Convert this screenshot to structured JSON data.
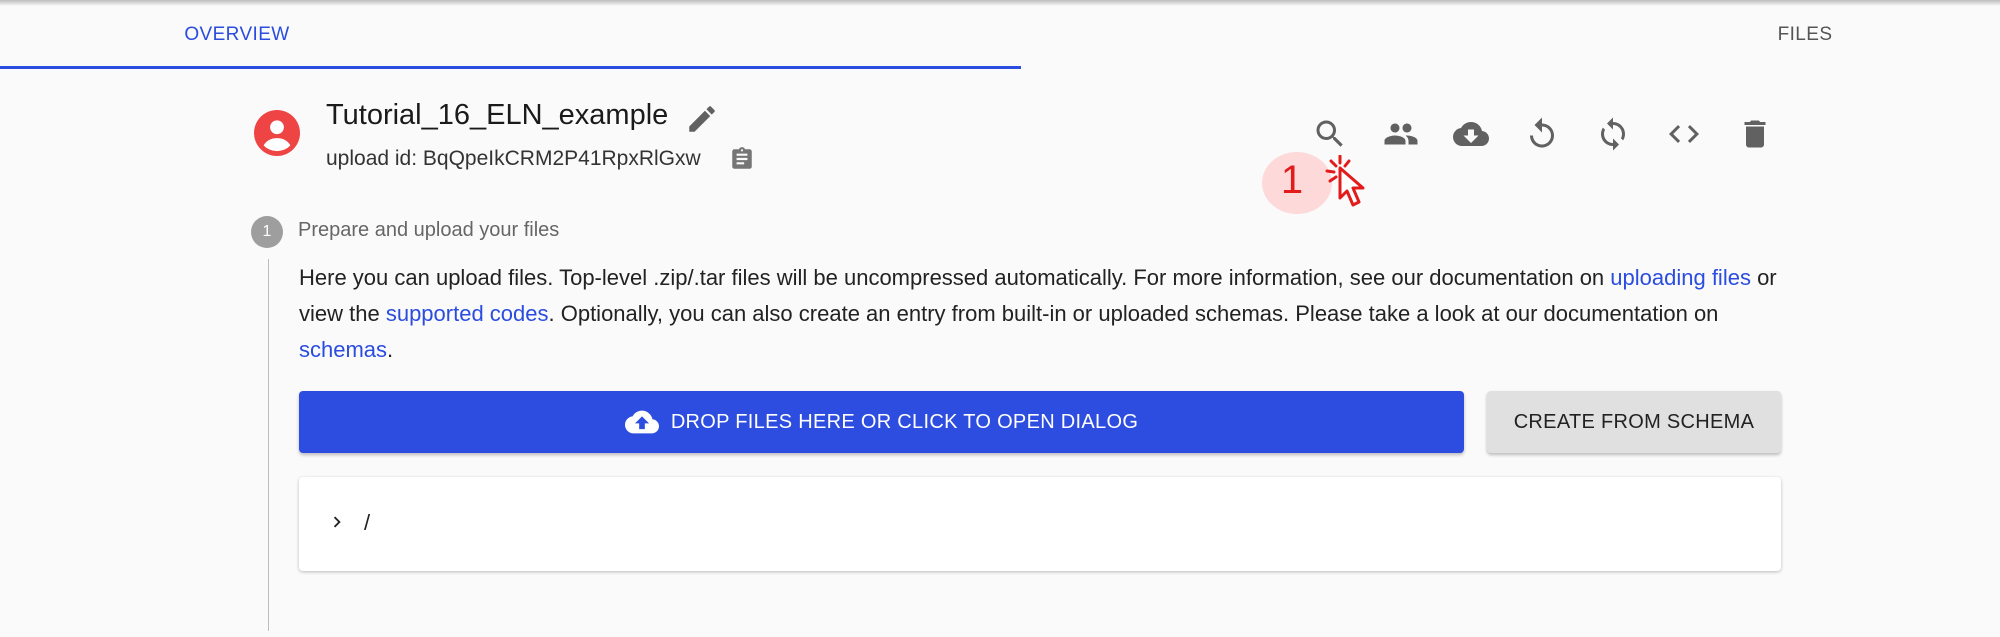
{
  "tabs": {
    "overview": "OVERVIEW",
    "files": "FILES"
  },
  "upload": {
    "title": "Tutorial_16_ELN_example",
    "id_text": "upload id: BqQpeIkCRM2P41RpxRlGxw"
  },
  "actions": [
    {
      "name": "search-icon"
    },
    {
      "name": "members-icon"
    },
    {
      "name": "cloud-download-icon"
    },
    {
      "name": "undo-icon"
    },
    {
      "name": "sync-icon"
    },
    {
      "name": "code-icon"
    },
    {
      "name": "delete-icon"
    }
  ],
  "annotation": {
    "number": "1"
  },
  "step": {
    "number": "1",
    "label": "Prepare and upload your files",
    "desc": {
      "t1": "Here you can upload files. Top-level .zip/.tar files will be uncompressed automatically. For more information, see our documentation on ",
      "link1": "uploading files",
      "t2": " or view the ",
      "link2": "supported codes",
      "t3": ". Optionally, you can also create an entry from built-in or uploaded schemas. Please take a look at our documentation on ",
      "link3": "schemas",
      "t4": "."
    },
    "drop_button": "DROP FILES HERE OR CLICK TO OPEN DIALOG",
    "schema_button": "CREATE FROM SCHEMA",
    "file_root": "/"
  },
  "colors": {
    "accent": "#2a4cdf",
    "avatar": "#ef4444",
    "annotation": "#e31b1b"
  }
}
